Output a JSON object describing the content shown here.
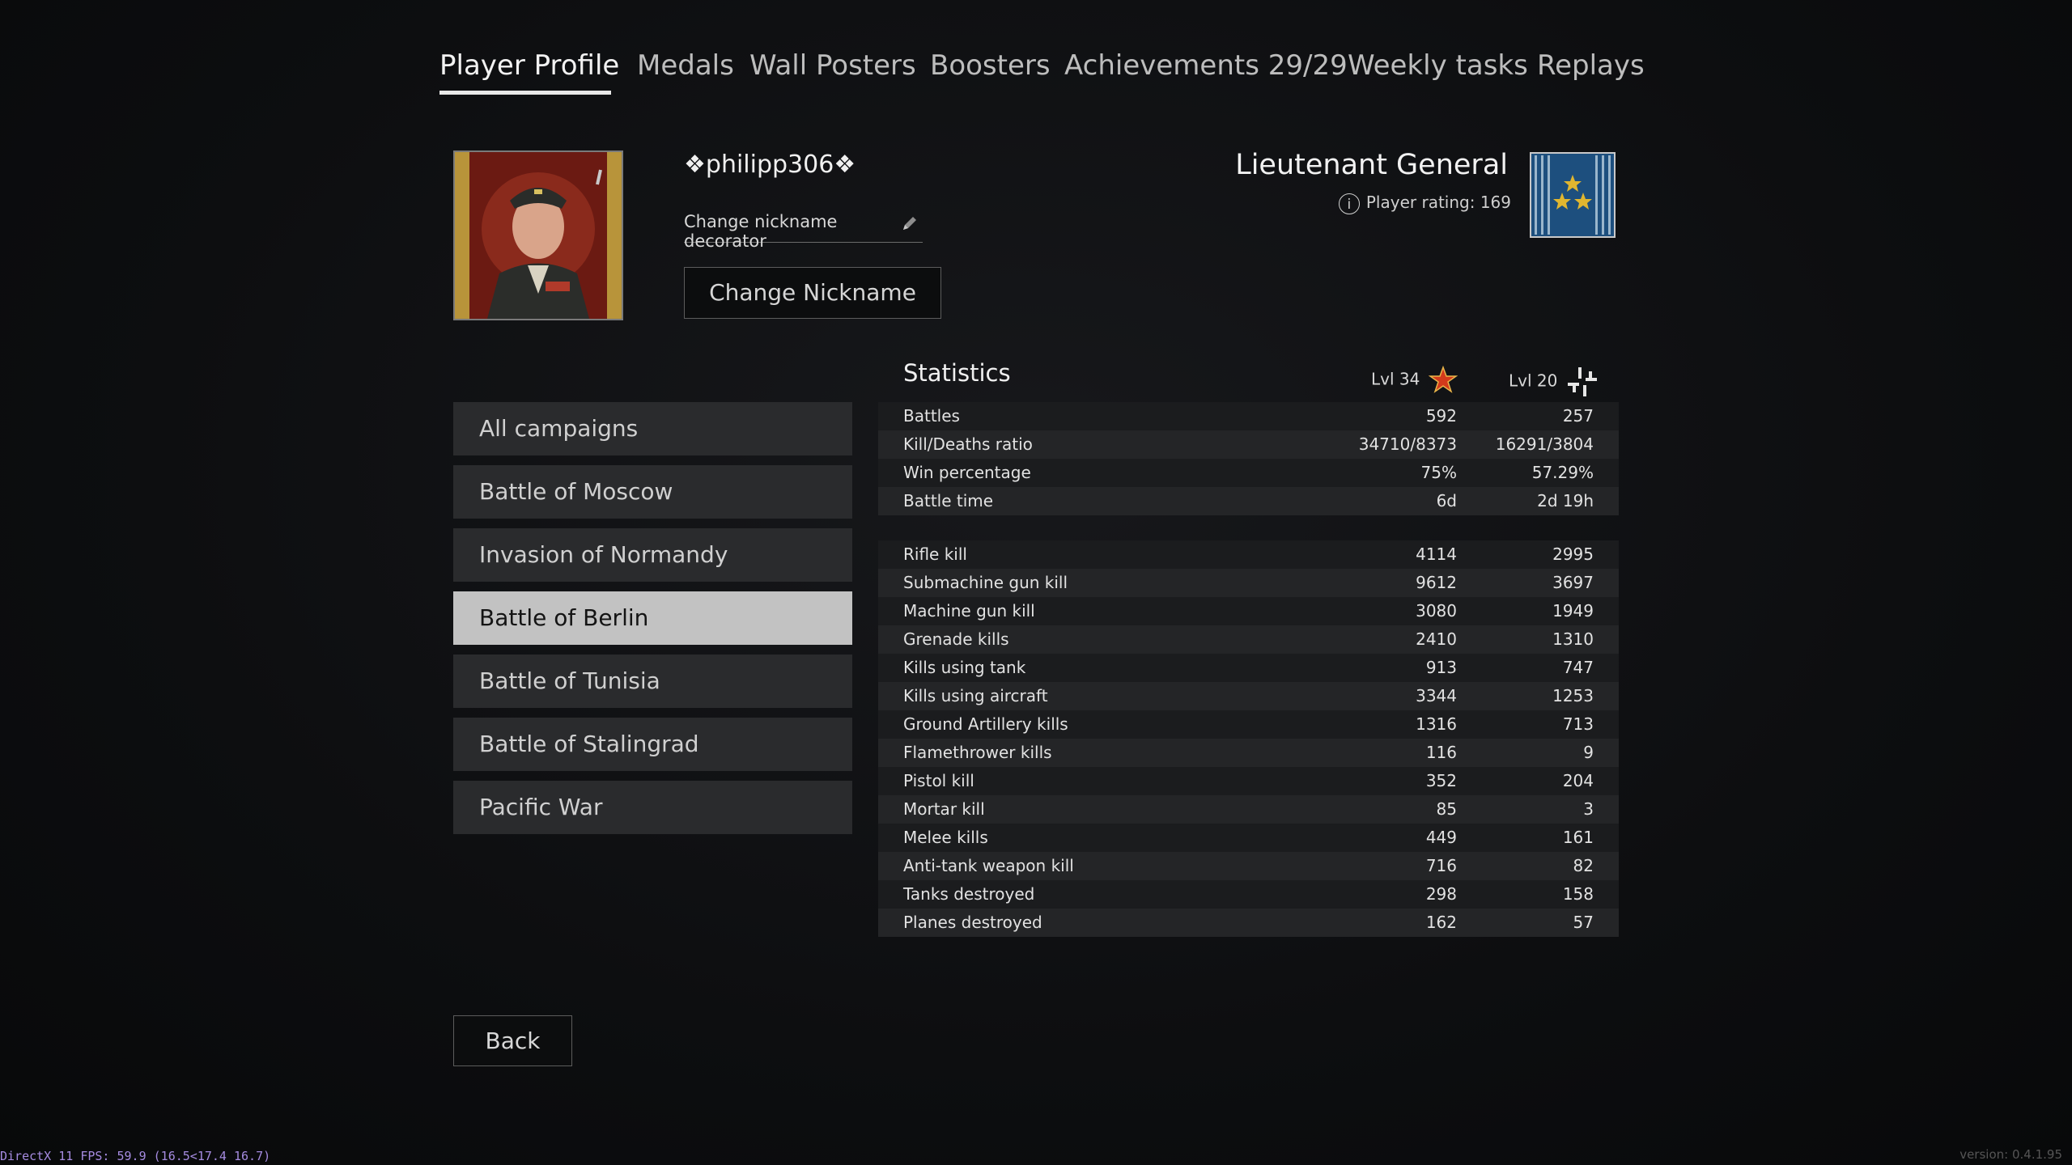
{
  "tabs": [
    {
      "label": "Player Profile",
      "active": true
    },
    {
      "label": "Medals"
    },
    {
      "label": "Wall Posters"
    },
    {
      "label": "Boosters"
    },
    {
      "label": "Achievements 29/29"
    },
    {
      "label": "Weekly tasks"
    },
    {
      "label": "Replays"
    }
  ],
  "profile": {
    "nickname": "❖philipp306❖",
    "decorator_label": "Change nickname decorator",
    "change_nickname_label": "Change Nickname",
    "rank": "Lieutenant General",
    "rating_text": "Player rating: 169"
  },
  "campaigns": [
    {
      "label": "All campaigns"
    },
    {
      "label": "Battle of Moscow"
    },
    {
      "label": "Invasion of Normandy"
    },
    {
      "label": "Battle of Berlin",
      "selected": true
    },
    {
      "label": "Battle of Tunisia"
    },
    {
      "label": "Battle of Stalingrad"
    },
    {
      "label": "Pacific War"
    }
  ],
  "statistics": {
    "title": "Statistics",
    "col1_level": "Lvl 34",
    "col2_level": "Lvl 20",
    "summary": [
      {
        "label": "Battles",
        "v1": "592",
        "v2": "257"
      },
      {
        "label": "Kill/Deaths ratio",
        "v1": "34710/8373",
        "v2": "16291/3804"
      },
      {
        "label": "Win percentage",
        "v1": "75%",
        "v2": "57.29%"
      },
      {
        "label": "Battle time",
        "v1": "6d",
        "v2": "2d 19h"
      }
    ],
    "kills": [
      {
        "label": "Rifle kill",
        "v1": "4114",
        "v2": "2995"
      },
      {
        "label": "Submachine gun kill",
        "v1": "9612",
        "v2": "3697"
      },
      {
        "label": "Machine gun kill",
        "v1": "3080",
        "v2": "1949"
      },
      {
        "label": "Grenade kills",
        "v1": "2410",
        "v2": "1310"
      },
      {
        "label": "Kills using tank",
        "v1": "913",
        "v2": "747"
      },
      {
        "label": "Kills using aircraft",
        "v1": "3344",
        "v2": "1253"
      },
      {
        "label": "Ground Artillery kills",
        "v1": "1316",
        "v2": "713"
      },
      {
        "label": "Flamethrower kills",
        "v1": "116",
        "v2": "9"
      },
      {
        "label": "Pistol kill",
        "v1": "352",
        "v2": "204"
      },
      {
        "label": "Mortar kill",
        "v1": "85",
        "v2": "3"
      },
      {
        "label": "Melee kills",
        "v1": "449",
        "v2": "161"
      },
      {
        "label": "Anti-tank weapon kill",
        "v1": "716",
        "v2": "82"
      },
      {
        "label": "Tanks destroyed",
        "v1": "298",
        "v2": "158"
      },
      {
        "label": "Planes destroyed",
        "v1": "162",
        "v2": "57"
      }
    ]
  },
  "back_label": "Back",
  "fps_text": "DirectX 11 FPS: 59.9 (16.5<17.4 16.7)",
  "version_text": "version: 0.4.1.95",
  "colors": {
    "selected_bg": "#c2c2c2",
    "panel_bg": "#2a2b2d",
    "row_bg": "#1b1c1e",
    "row_alt_bg": "#242527"
  }
}
